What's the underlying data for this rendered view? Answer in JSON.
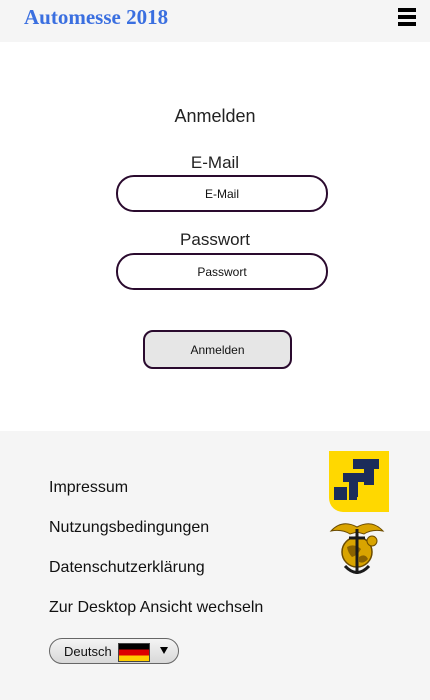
{
  "header": {
    "brand": "Automesse 2018",
    "menu_icon": "hamburger-menu-icon"
  },
  "login": {
    "title": "Anmelden",
    "email_label": "E-Mail",
    "email_placeholder": "E-Mail",
    "password_label": "Passwort",
    "password_placeholder": "Passwort",
    "submit_label": "Anmelden"
  },
  "footer": {
    "links": [
      "Impressum",
      "Nutzungsbedingungen",
      "Datenschutzerklärung",
      "Zur Desktop Ansicht wechseln"
    ],
    "language": {
      "selected": "Deutsch",
      "flag_icon": "german-flag-icon"
    },
    "logos": [
      "yellow-block-logo",
      "eagle-globe-anchor-emblem"
    ]
  },
  "colors": {
    "brand": "#3a6fe0",
    "input_border": "#2a0a2e",
    "logo_yellow": "#ffd800",
    "logo_navy": "#1c2c5a",
    "emblem_gold": "#d9a400",
    "page_bg": "#f5f5f5"
  }
}
